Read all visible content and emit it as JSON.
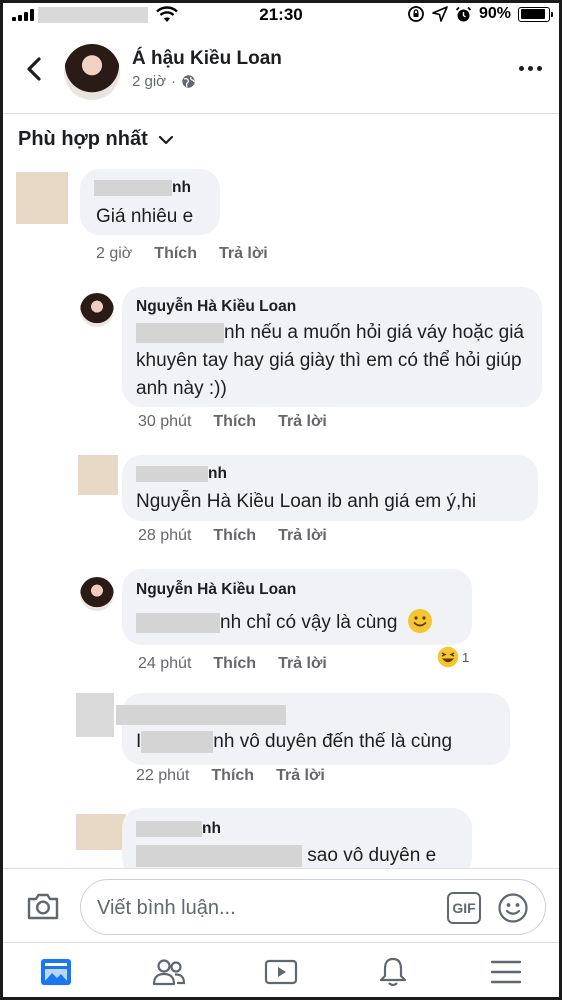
{
  "status_bar": {
    "time": "21:30",
    "battery": "90%",
    "battery_level": 0.9
  },
  "header": {
    "name": "Á hậu Kiều Loan",
    "time": "2 giờ",
    "privacy_icon": "globe-icon"
  },
  "sort": {
    "label": "Phù hợp nhất"
  },
  "comments": [
    {
      "name_tail": "nh",
      "text": "Giá nhiêu e",
      "time": "2 giờ",
      "like": "Thích",
      "reply": "Trả lời"
    },
    {
      "name": "Nguyễn Hà Kiều Loan",
      "text_after_blur": "nh nếu a muốn hỏi giá váy hoặc giá khuyên tay hay giá giày thì em có thể hỏi giúp anh này :))",
      "time": "30 phút",
      "like": "Thích",
      "reply": "Trả lời"
    },
    {
      "name_tail": "nh",
      "text": "Nguyễn Hà Kiều Loan ib anh giá em ý,hi",
      "time": "28 phút",
      "like": "Thích",
      "reply": "Trả lời"
    },
    {
      "name": "Nguyễn Hà Kiều Loan",
      "text_after_blur": "nh chỉ có vậy là cùng",
      "time": "24 phút",
      "like": "Thích",
      "reply": "Trả lời",
      "reaction_count": "1"
    },
    {
      "text_prefix": "I",
      "text_after_blur": "nh vô duyên đến thế là cùng",
      "time": "22 phút",
      "like": "Thích",
      "reply": "Trả lời"
    },
    {
      "name_tail": "nh",
      "text_after_blur": "sao vô duyên e"
    }
  ],
  "composer": {
    "placeholder": "Viết bình luận...",
    "gif_label": "GIF"
  },
  "tabbar": [
    "news-feed-icon",
    "friends-icon",
    "watch-icon",
    "notifications-icon",
    "menu-icon"
  ]
}
